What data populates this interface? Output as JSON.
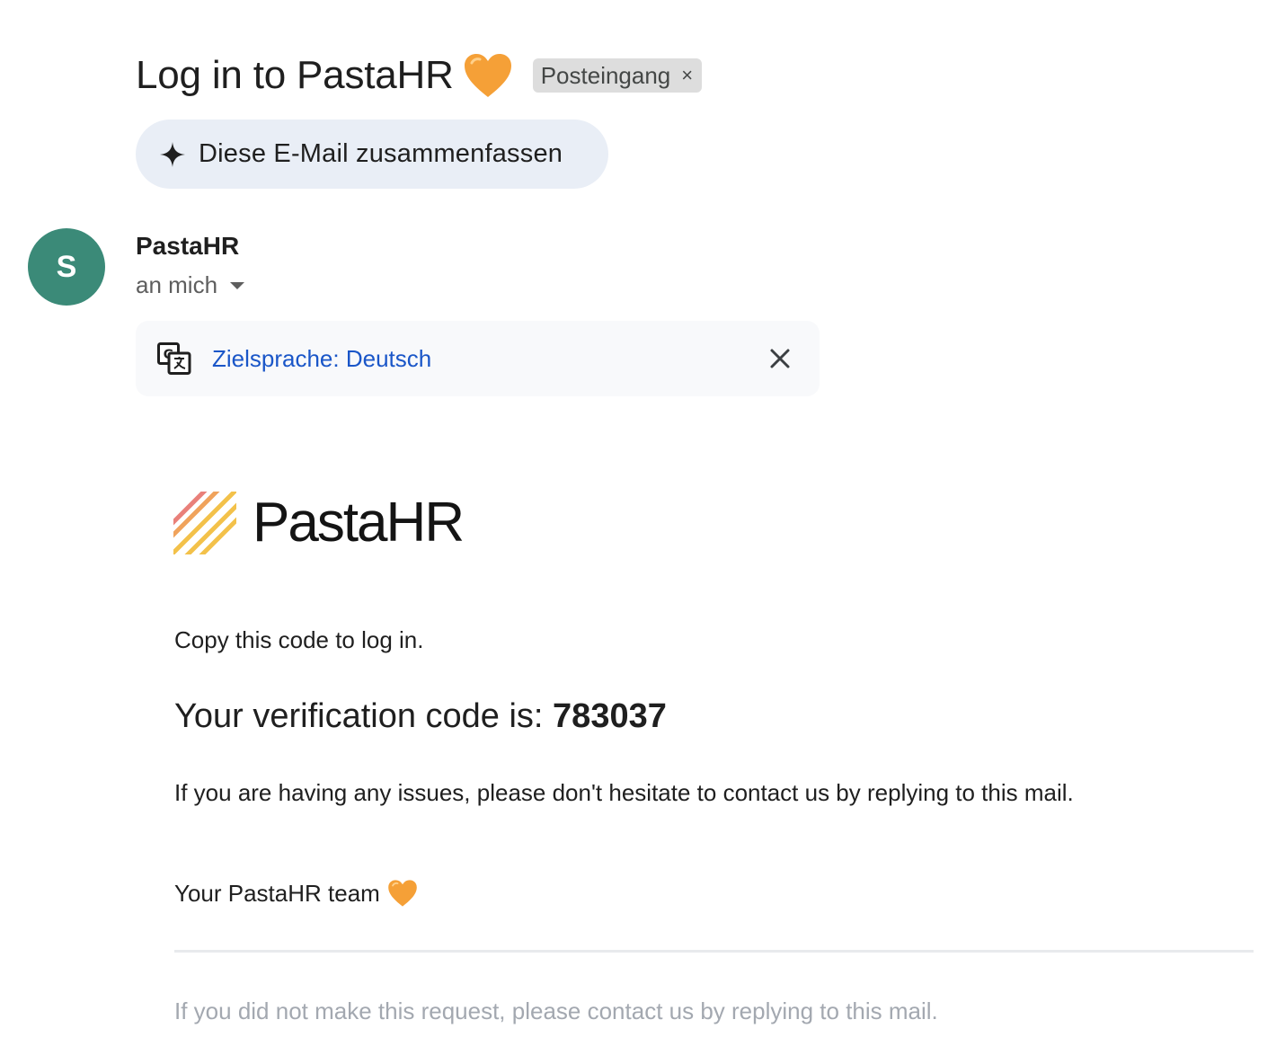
{
  "email": {
    "subject": "Log in to PastaHR",
    "subject_emoji": "orange-heart-icon",
    "label": "Posteingang",
    "label_remove": "×",
    "summarize_label": "Diese E-Mail zusammenfassen",
    "sender": {
      "initial": "S",
      "name": "PastaHR",
      "recipient": "an mich",
      "avatar_color": "#3b8a78"
    },
    "translate": {
      "link": "Zielsprache: Deutsch"
    },
    "body": {
      "brand": "PastaHR",
      "intro": "Copy this code to log in.",
      "code_prefix": "Your verification code is: ",
      "code": "783037",
      "help": "If you are having any issues, please don't hesitate to contact us by replying to this mail.",
      "signoff": "Your PastaHR team",
      "footer": "If you did not make this request, please contact us by replying to this mail."
    }
  },
  "colors": {
    "heart": "#f5a037",
    "link": "#1a56c8",
    "summarize_bg": "#e9eef6",
    "translate_bg": "#f8f9fb",
    "footer_text": "#a3a8b0"
  }
}
